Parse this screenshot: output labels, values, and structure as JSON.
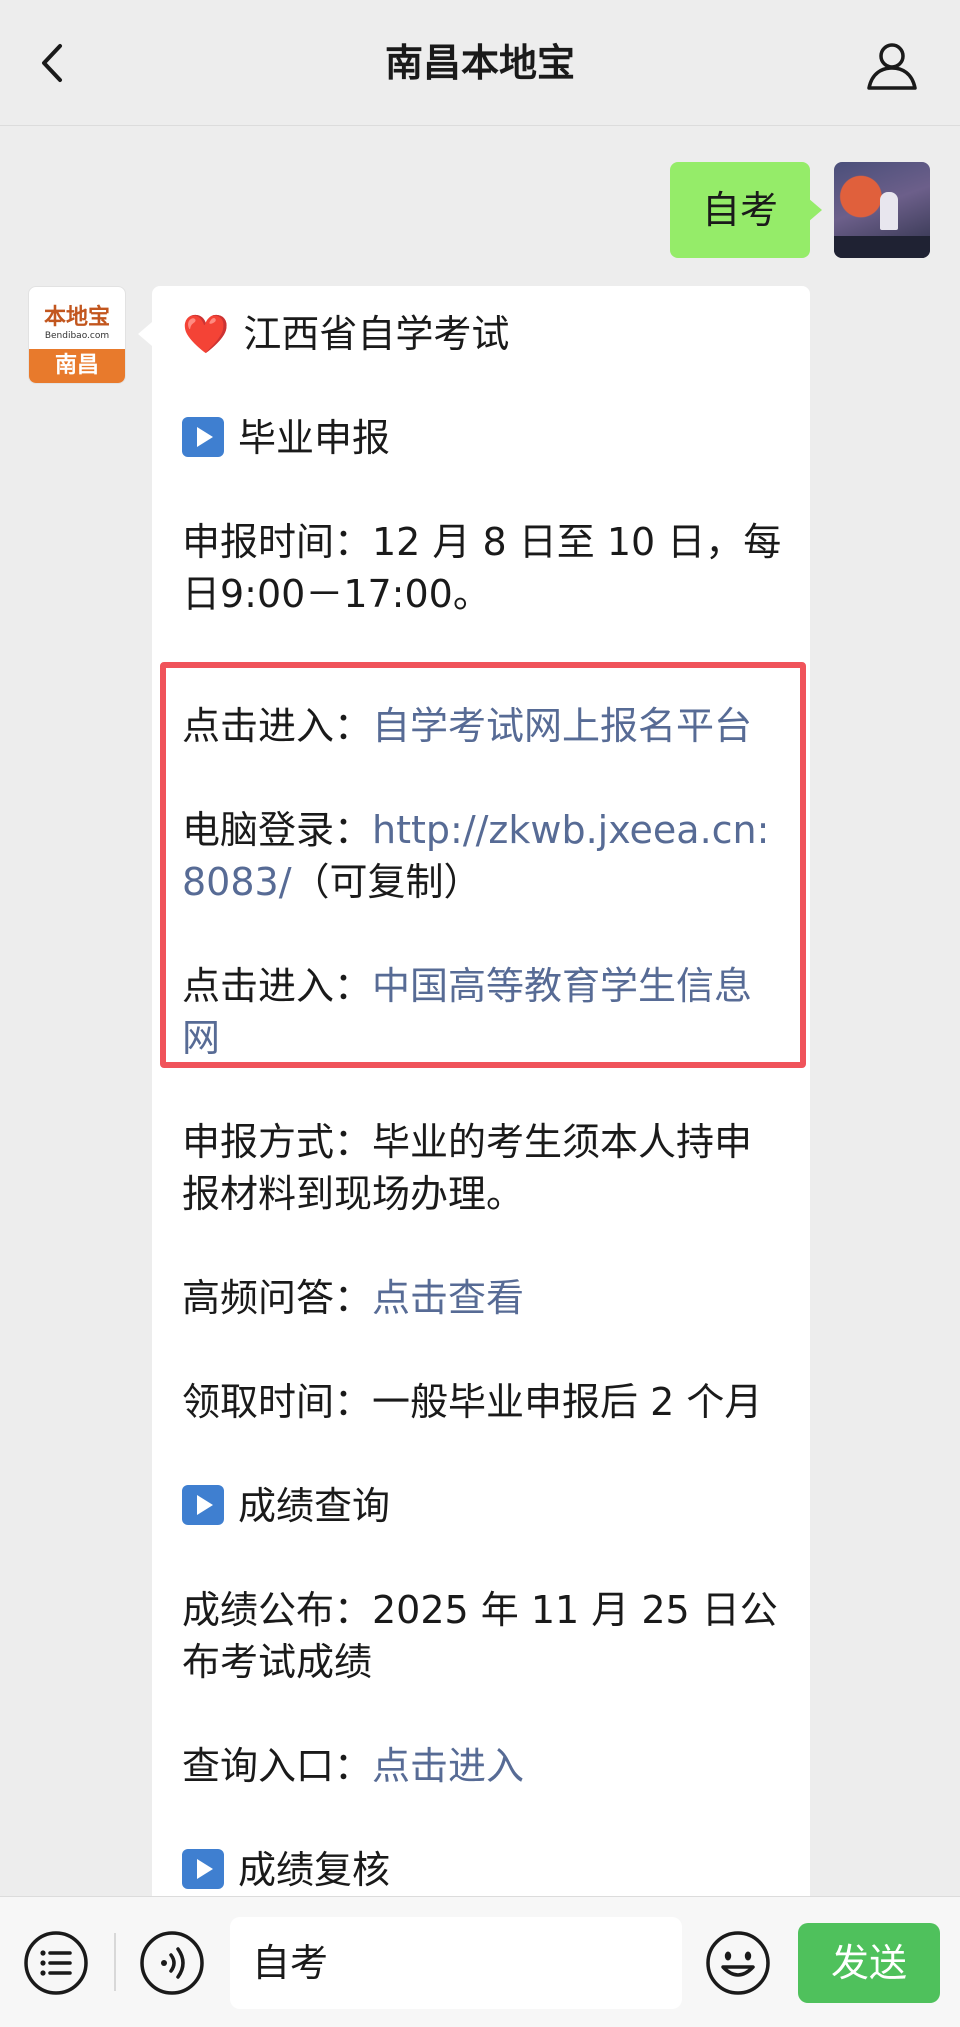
{
  "header": {
    "title": "南昌本地宝"
  },
  "sent_message": {
    "text": "自考"
  },
  "bot_avatar": {
    "logo_top": "本地宝",
    "logo_url": "Bendibao.com",
    "logo_bottom": "南昌"
  },
  "message": {
    "heading_emoji": "❤️",
    "heading": "江西省自学考试",
    "section1": "毕业申报",
    "apply_time_1": "申报时间：12 月 8 日至 10 日，每",
    "apply_time_2": "日9:00－17:00。",
    "entry1_label": "点击进入：",
    "entry1_link": "自学考试网上报名平台",
    "pc_label": "电脑登录：",
    "pc_link_1": "http://zkwb.jxeea.cn:",
    "pc_link_2": "8083/",
    "pc_note": "（可复制）",
    "entry2_label": "点击进入：",
    "entry2_link_1": "中国高等教育学生信息",
    "entry2_link_2": "网",
    "method_1": "申报方式：毕业的考生须本人持申",
    "method_2": "报材料到现场办理。",
    "faq_label": "高频问答：",
    "faq_link": "点击查看",
    "receive_time": "领取时间：一般毕业申报后 2 个月",
    "section2": "成绩查询",
    "score_publish_1": "成绩公布：2025 年 11 月 25 日公",
    "score_publish_2": "布考试成绩",
    "query_label": "查询入口：",
    "query_link": "点击进入",
    "section3": "成绩复核"
  },
  "input": {
    "value": "自考"
  },
  "send_label": "发送"
}
